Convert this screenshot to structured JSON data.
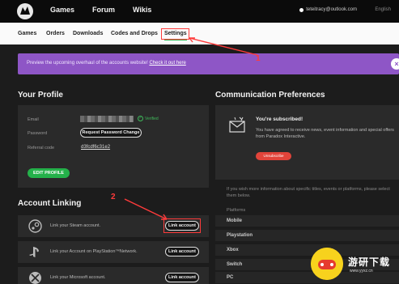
{
  "topnav": {
    "links": [
      "Games",
      "Forum",
      "Wikis"
    ],
    "account_email": "teteitracy@outlook.com",
    "language": "English"
  },
  "subnav": {
    "items": [
      "Games",
      "Orders",
      "Downloads",
      "Codes and Drops",
      "Settings"
    ],
    "active": "Settings"
  },
  "banner": {
    "text": "Preview the upcoming overhaul of the accounts website!",
    "link": "Check it out here",
    "close_icon": "close-icon"
  },
  "profile": {
    "title": "Your Profile",
    "email_label": "Email",
    "verified_label": "Verified",
    "password_label": "Password",
    "password_button": "Request Password Change",
    "referral_label": "Referral code",
    "referral_code": "d3fcdf6c31e2",
    "edit_button": "EDIT PROFILE"
  },
  "linking": {
    "title": "Account Linking",
    "rows": [
      {
        "icon": "steam-icon",
        "text": "Link your Steam account.",
        "button": "Link account"
      },
      {
        "icon": "playstation-icon",
        "text": "Link your Account on PlayStation™Network.",
        "button": "Link account"
      },
      {
        "icon": "xbox-icon",
        "text": "Link your Microsoft account.",
        "button": "Link account"
      }
    ]
  },
  "comms": {
    "title": "Communication Preferences",
    "subscribed_title": "You're subscribed!",
    "subscribed_text": "You have agreed to receive news, event information and special offers from Paradox Interactive.",
    "unsubscribe_button": "Unsubscribe",
    "info_text": "If you wish more information about specific titles, events or platforms, please select them below.",
    "platforms_label": "Platforms",
    "platforms": [
      "Mobile",
      "Playstation",
      "Xbox",
      "Switch",
      "PC"
    ]
  },
  "annotations": {
    "step1": "1",
    "step2": "2"
  },
  "watermark": {
    "text": "游研下载",
    "sub": "www.yyxz.cn"
  },
  "colors": {
    "accent_green": "#24b14a",
    "banner_purple": "#8e56c6",
    "annotation_red": "#ff3b3b",
    "unsubscribe_red": "#e2443a"
  }
}
